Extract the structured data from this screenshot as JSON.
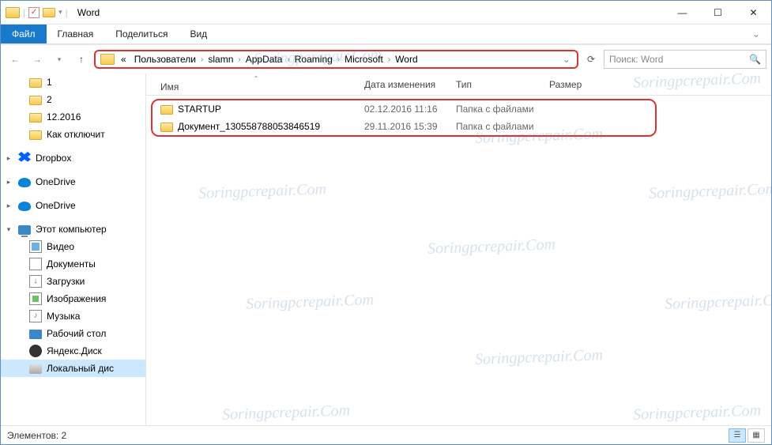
{
  "titlebar": {
    "title": "Word"
  },
  "ribbon": {
    "file": "Файл",
    "tabs": [
      "Главная",
      "Поделиться",
      "Вид"
    ]
  },
  "breadcrumbs": [
    "Пользователи",
    "slamn",
    "AppData",
    "Roaming",
    "Microsoft",
    "Word"
  ],
  "breadcrumb_prefix": "«",
  "search": {
    "placeholder": "Поиск: Word"
  },
  "sidebar": {
    "pinned": [
      {
        "label": "1",
        "icon": "folder"
      },
      {
        "label": "2",
        "icon": "folder"
      },
      {
        "label": "12.2016",
        "icon": "folder"
      },
      {
        "label": "Как отключит",
        "icon": "folder"
      }
    ],
    "cloud": [
      {
        "label": "Dropbox",
        "icon": "dropbox"
      },
      {
        "label": "OneDrive",
        "icon": "onedrive"
      },
      {
        "label": "OneDrive",
        "icon": "onedrive"
      }
    ],
    "thispc_label": "Этот компьютер",
    "thispc": [
      {
        "label": "Видео",
        "icon": "video"
      },
      {
        "label": "Документы",
        "icon": "doc"
      },
      {
        "label": "Загрузки",
        "icon": "down"
      },
      {
        "label": "Изображения",
        "icon": "img"
      },
      {
        "label": "Музыка",
        "icon": "music"
      },
      {
        "label": "Рабочий стол",
        "icon": "desktop"
      },
      {
        "label": "Яндекс.Диск",
        "icon": "yandex"
      },
      {
        "label": "Локальный дис",
        "icon": "disk"
      }
    ]
  },
  "columns": {
    "name": "Имя",
    "date": "Дата изменения",
    "type": "Тип",
    "size": "Размер"
  },
  "files": [
    {
      "name": "STARTUP",
      "date": "02.12.2016 11:16",
      "type": "Папка с файлами",
      "size": ""
    },
    {
      "name": "Документ_130558788053846519",
      "date": "29.11.2016 15:39",
      "type": "Папка с файлами",
      "size": ""
    }
  ],
  "status": {
    "count_label": "Элементов: 2"
  },
  "watermark": "Soringpcrepair.Com"
}
